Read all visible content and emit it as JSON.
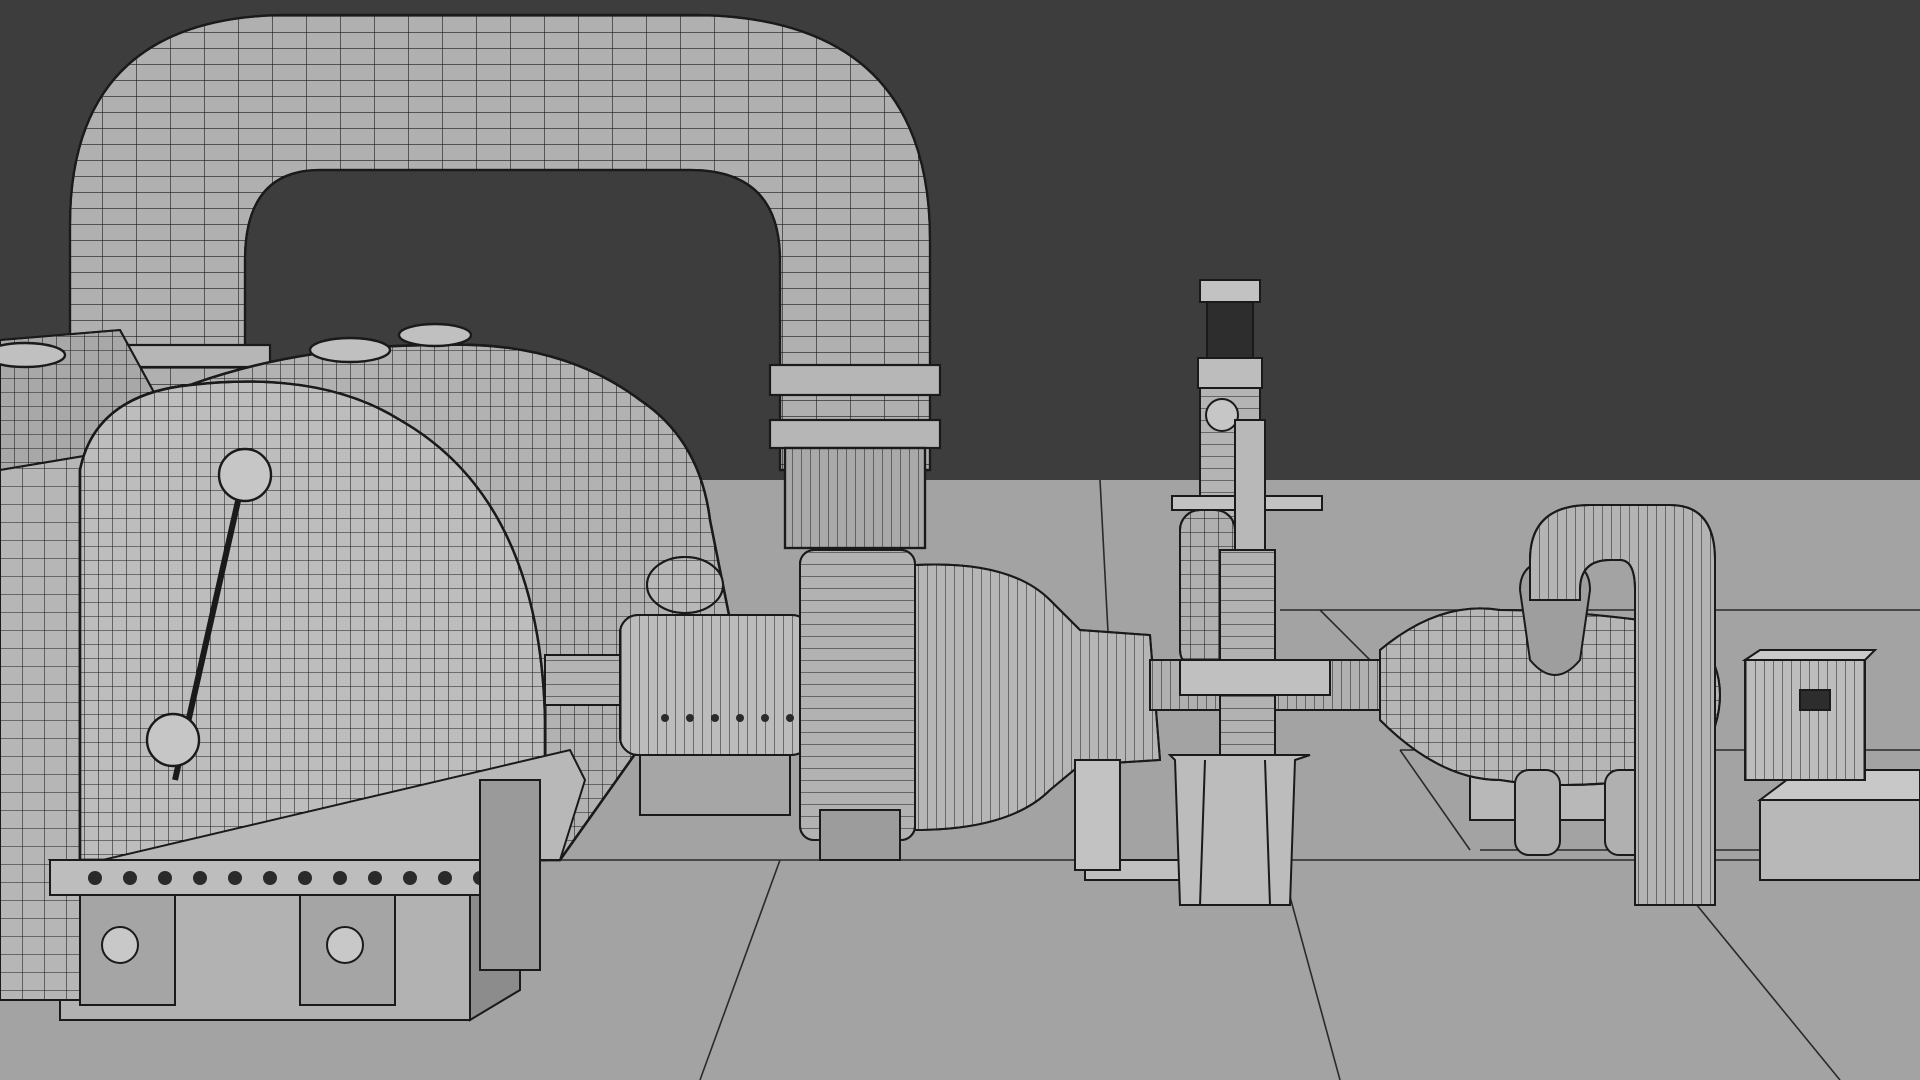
{
  "scene": {
    "colors": {
      "background": "#3d3d3d",
      "floor": "#a3a3a3",
      "floor_lines": "#2a2a2a",
      "surface_light": "#c4c4c4",
      "surface_mid": "#a6a6a6",
      "surface_dark": "#7a7a7a",
      "wire": "#1a1a1a"
    },
    "objects": [
      "steam-turbine-casing",
      "crossover-pipe",
      "generator-coupling",
      "exhaust-diffuser",
      "valve-actuator",
      "support-column",
      "auxiliary-vessel",
      "return-pipe",
      "end-housing",
      "foundation-plinths"
    ]
  }
}
